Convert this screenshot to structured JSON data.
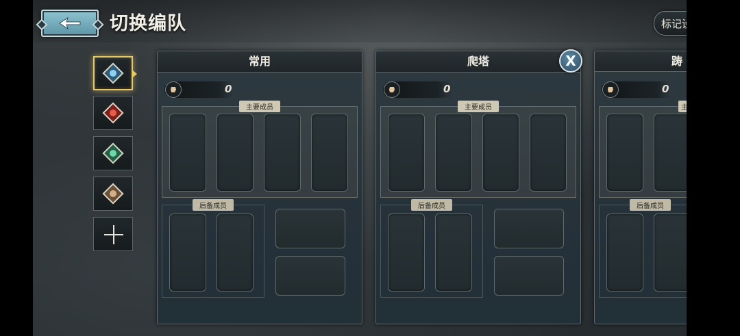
{
  "header": {
    "title": "切换编队",
    "mark_settings_label": "标记设置"
  },
  "element_tabs": [
    {
      "name": "ice",
      "color": "#5fa8d6"
    },
    {
      "name": "fire",
      "color": "#c9423b"
    },
    {
      "name": "wind",
      "color": "#4fb38a"
    },
    {
      "name": "earth",
      "color": "#b08a62"
    },
    {
      "name": "add"
    }
  ],
  "teams": [
    {
      "name": "常用",
      "power": "0",
      "main_label": "主要成员",
      "reserve_label": "后备成员"
    },
    {
      "name": "爬塔",
      "power": "0",
      "main_label": "主要成员",
      "reserve_label": "后备成员"
    },
    {
      "name": "踌",
      "power": "0",
      "main_label": "主",
      "reserve_label": "后备成员"
    }
  ],
  "close_label": "X",
  "icons": {
    "back": "back-arrow-icon",
    "feather": "feather-icon",
    "fist": "fist-icon",
    "plus": "plus-icon"
  },
  "colors": {
    "active_border": "#e8c766",
    "panel": "#2e3a40"
  }
}
